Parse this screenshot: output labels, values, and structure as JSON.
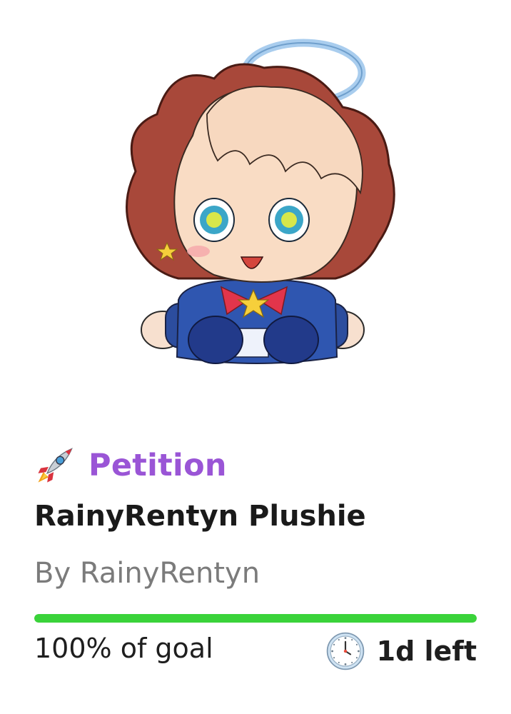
{
  "card": {
    "image_icon": "chibi-plushie-character-illustration",
    "tag": {
      "icon": "rocket-icon",
      "label": "Petition",
      "color": "#9a55d6"
    },
    "title": "RainyRentyn Plushie",
    "creator": "By RainyRentyn",
    "progress": {
      "percent": 100,
      "fill_color": "#3ad33a"
    },
    "funding_text": "100% of goal",
    "time": {
      "icon": "clock-icon",
      "label": "1d left"
    }
  }
}
